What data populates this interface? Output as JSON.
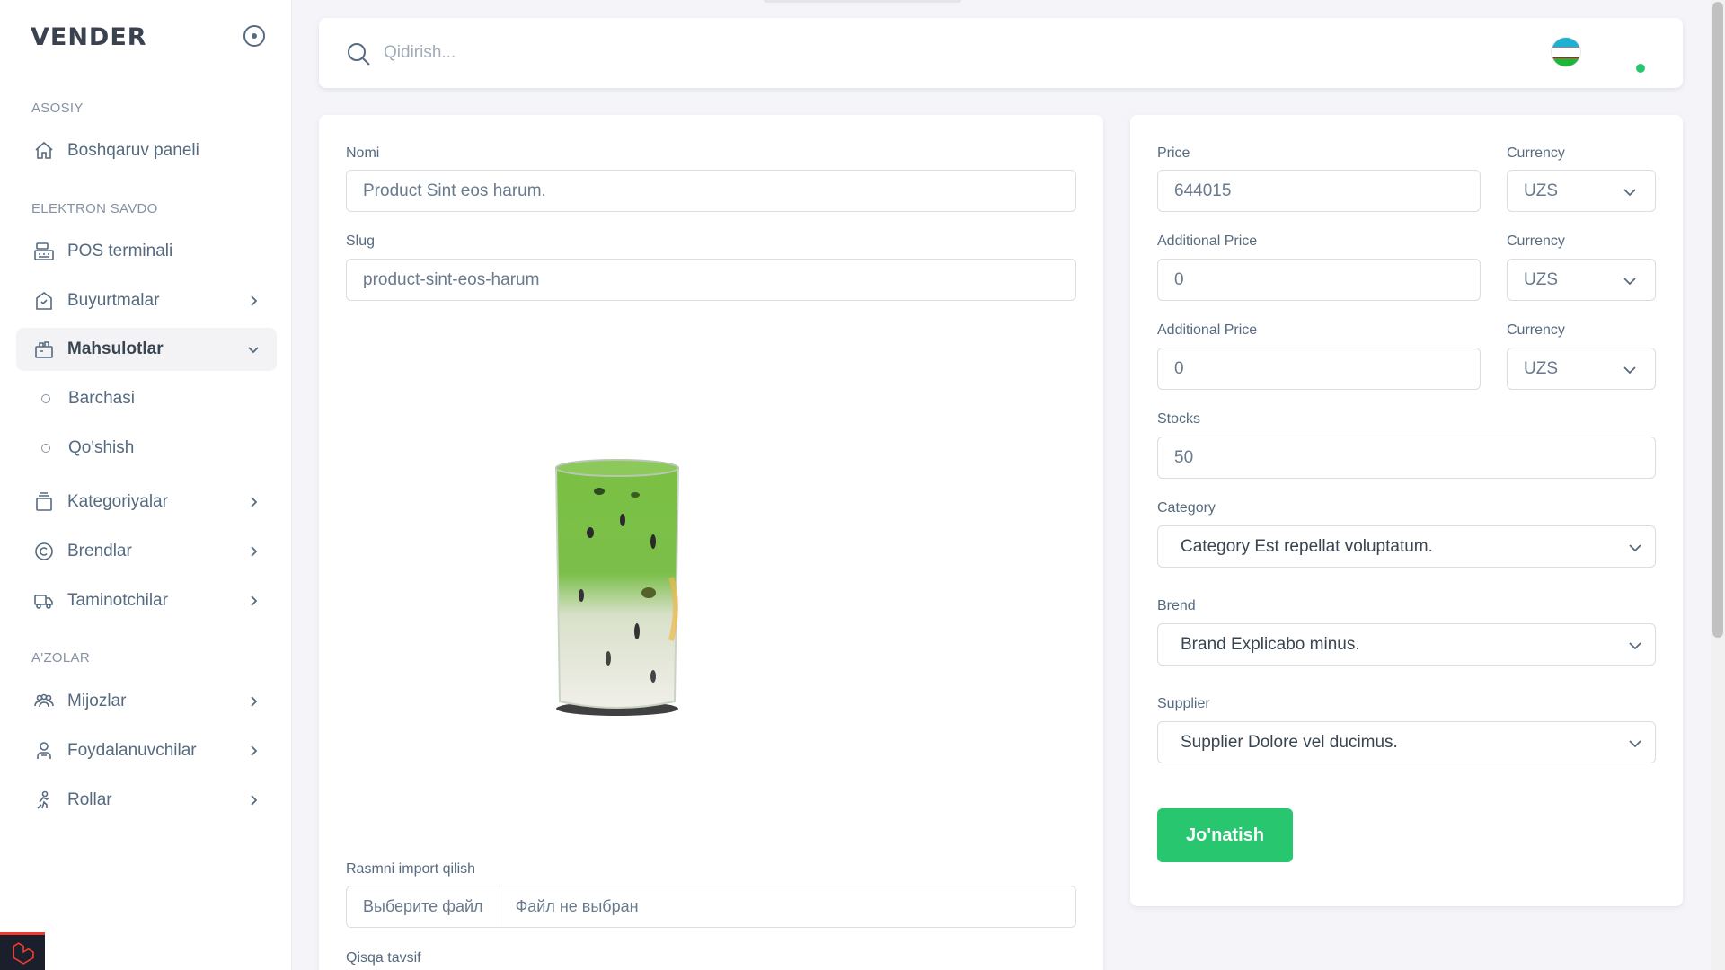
{
  "brand": {
    "name": "VENDER"
  },
  "sidebar": {
    "sections": [
      {
        "header": "ASOSIY"
      },
      {
        "header": "ELEKTRON SAVDO"
      },
      {
        "header": "A'ZOLAR"
      }
    ],
    "items": [
      {
        "label": "Boshqaruv paneli",
        "icon": "home-icon"
      },
      {
        "label": "POS terminali",
        "icon": "pos-terminal-icon"
      },
      {
        "label": "Buyurtmalar",
        "icon": "orders-icon"
      },
      {
        "label": "Mahsulotlar",
        "icon": "products-icon"
      },
      {
        "label": "Kategoriyalar",
        "icon": "categories-icon"
      },
      {
        "label": "Brendlar",
        "icon": "copyright-icon"
      },
      {
        "label": "Taminotchilar",
        "icon": "truck-icon"
      },
      {
        "label": "Mijozlar",
        "icon": "customers-icon"
      },
      {
        "label": "Foydalanuvchilar",
        "icon": "users-icon"
      },
      {
        "label": "Rollar",
        "icon": "roles-icon"
      }
    ],
    "sub_items": [
      {
        "label": "Barchasi"
      },
      {
        "label": "Qo'shish"
      }
    ]
  },
  "navbar": {
    "search_placeholder": "Qidirish...",
    "language_flag": "uz-flag-icon",
    "status_color": "#28c76f"
  },
  "form": {
    "name_label": "Nomi",
    "name_value": "Product Sint eos harum.",
    "slug_label": "Slug",
    "slug_value": "product-sint-eos-harum",
    "image_import_label": "Rasmni import qilish",
    "file_button": "Выберите файл",
    "file_status": "Файл не выбран",
    "short_desc_label": "Qisqa tavsif",
    "price_label": "Price",
    "price_value": "644015",
    "currency_label": "Currency",
    "currency_value": "UZS",
    "additional_price_label": "Additional Price",
    "additional_price_1": "0",
    "additional_price_2": "0",
    "stocks_label": "Stocks",
    "stocks_value": "50",
    "category_label": "Category",
    "category_value": "Category Est repellat voluptatum.",
    "brand_label": "Brend",
    "brand_value": "Brand Explicabo minus.",
    "supplier_label": "Supplier",
    "supplier_value": "Supplier Dolore vel ducimus.",
    "submit_label": "Jo'natish"
  },
  "colors": {
    "accent_green": "#28c76f",
    "text": "#566a7f",
    "laravel_red": "#ef3b2d"
  }
}
